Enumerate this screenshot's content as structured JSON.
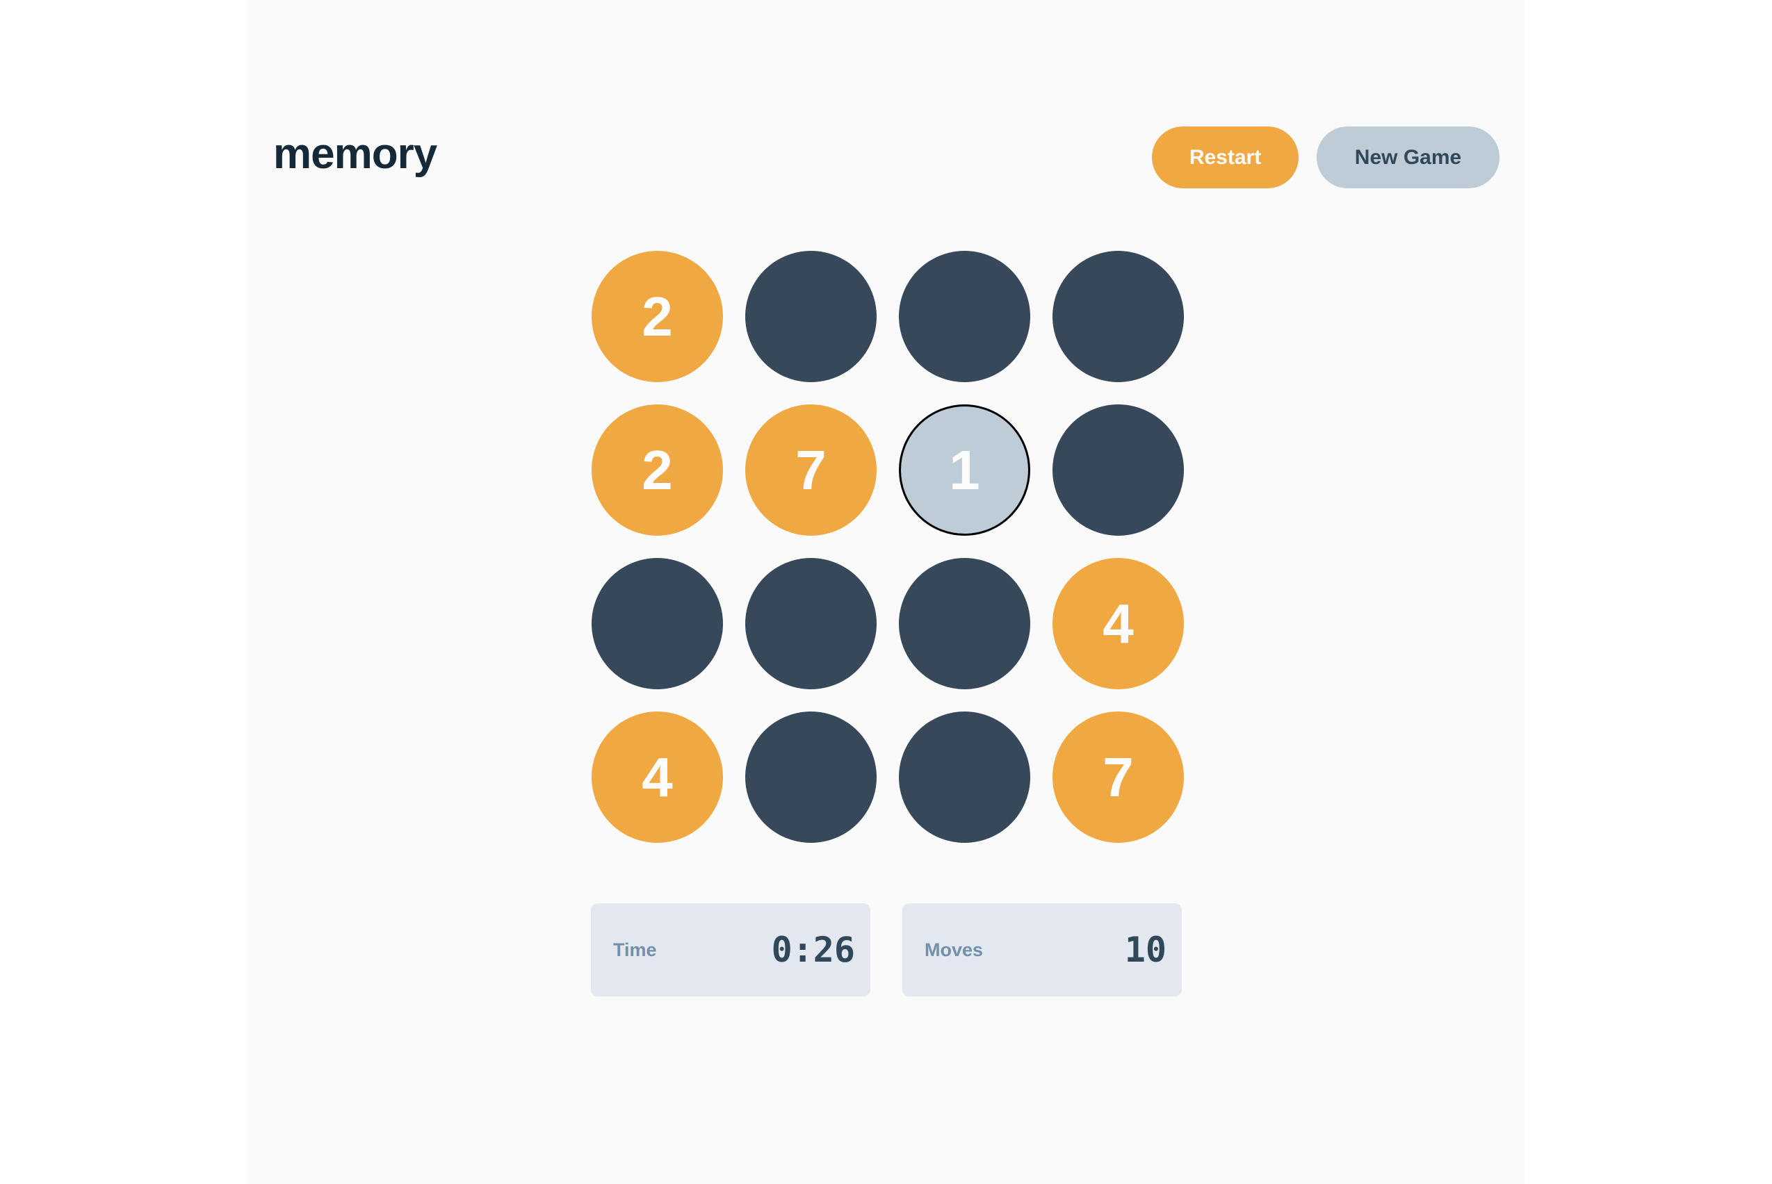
{
  "header": {
    "title": "memory",
    "restart_label": "Restart",
    "new_game_label": "New Game"
  },
  "board": {
    "tiles": [
      {
        "state": "matched",
        "value": "2"
      },
      {
        "state": "hidden",
        "value": ""
      },
      {
        "state": "hidden",
        "value": ""
      },
      {
        "state": "hidden",
        "value": ""
      },
      {
        "state": "matched",
        "value": "2"
      },
      {
        "state": "matched",
        "value": "7"
      },
      {
        "state": "active",
        "value": "1"
      },
      {
        "state": "hidden",
        "value": ""
      },
      {
        "state": "hidden",
        "value": ""
      },
      {
        "state": "hidden",
        "value": ""
      },
      {
        "state": "hidden",
        "value": ""
      },
      {
        "state": "matched",
        "value": "4"
      },
      {
        "state": "matched",
        "value": "4"
      },
      {
        "state": "hidden",
        "value": ""
      },
      {
        "state": "hidden",
        "value": ""
      },
      {
        "state": "matched",
        "value": "7"
      }
    ]
  },
  "stats": {
    "time_label": "Time",
    "time_value": "0:26",
    "moves_label": "Moves",
    "moves_value": "10"
  },
  "colors": {
    "accent": "#f0a942",
    "hidden": "#364859",
    "active": "#bdccd6",
    "title": "#152938"
  }
}
